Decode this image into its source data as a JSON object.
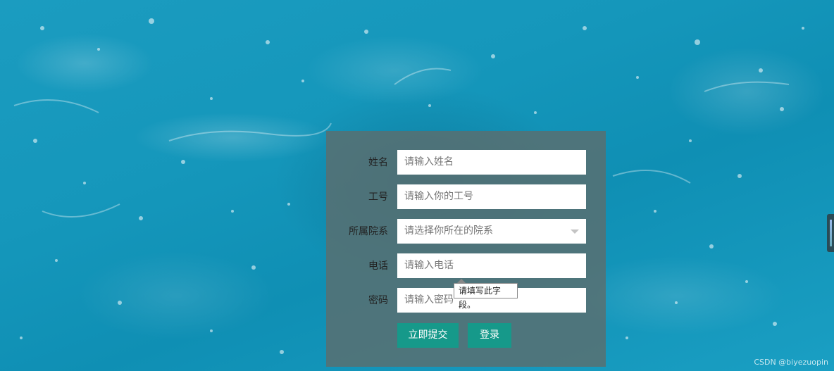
{
  "form": {
    "fields": [
      {
        "label": "姓名",
        "placeholder": "请输入姓名"
      },
      {
        "label": "工号",
        "placeholder": "请输入你的工号"
      },
      {
        "label": "所属院系",
        "placeholder": "请选择你所在的院系"
      },
      {
        "label": "电话",
        "placeholder": "请输入电话"
      },
      {
        "label": "密码",
        "placeholder": "请输入密码"
      }
    ],
    "submit_label": "立即提交",
    "login_label": "登录"
  },
  "tooltip": "请填写此字段。",
  "watermark": "CSDN @biyezuopin",
  "colors": {
    "panel": "#5c6e6e",
    "button": "#16998a",
    "background": "#1597bb"
  }
}
